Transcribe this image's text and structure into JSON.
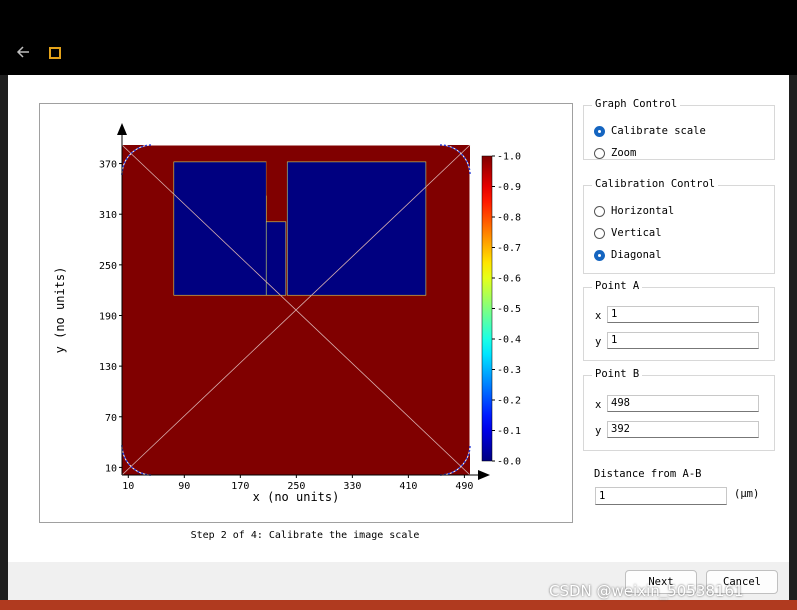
{
  "graph_control": {
    "title": "Graph Control",
    "options": [
      "Calibrate scale",
      "Zoom"
    ],
    "selected": "Calibrate scale"
  },
  "calibration_control": {
    "title": "Calibration Control",
    "options": [
      "Horizontal",
      "Vertical",
      "Diagonal"
    ],
    "selected": "Diagonal"
  },
  "point_a": {
    "title": "Point A",
    "x_label": "x",
    "x_value": "1",
    "y_label": "y",
    "y_value": "1"
  },
  "point_b": {
    "title": "Point B",
    "x_label": "x",
    "x_value": "498",
    "y_label": "y",
    "y_value": "392"
  },
  "distance": {
    "label": "Distance from A-B",
    "value": "1",
    "unit": "(μm)"
  },
  "step_label": "Step 2 of 4: Calibrate the image scale",
  "buttons": {
    "next": "Next",
    "cancel": "Cancel"
  },
  "watermark": "CSDN @weixin_50538161",
  "colors": {
    "accent": "#1565c0",
    "image_background": "#800000",
    "image_regions": "#00008f",
    "app_icon": "#e3a21a"
  },
  "chart_data": {
    "type": "heatmap",
    "xlabel": "x (no units)",
    "ylabel": "y (no units)",
    "x_ticks": [
      "10",
      "90",
      "170",
      "250",
      "330",
      "410",
      "490"
    ],
    "y_ticks": [
      "10",
      "70",
      "130",
      "190",
      "250",
      "310",
      "370"
    ],
    "xlim": [
      1,
      498
    ],
    "ylim": [
      1,
      392
    ],
    "colorbar_ticks": [
      "0.0",
      "0.1",
      "0.2",
      "0.3",
      "0.4",
      "0.5",
      "0.6",
      "0.7",
      "0.8",
      "0.9",
      "1.0"
    ],
    "colorbar_range": [
      0,
      1
    ],
    "colormap": "jet",
    "background_value": 1.0,
    "regions": [
      {
        "value": 0.0,
        "x": [
          75,
          207
        ],
        "y": [
          214,
          372
        ]
      },
      {
        "value": 0.0,
        "x": [
          207,
          235
        ],
        "y": [
          214,
          301
        ]
      },
      {
        "value": 0.0,
        "x": [
          237,
          435
        ],
        "y": [
          214,
          372
        ]
      }
    ],
    "calibration_line": {
      "from": [
        1,
        1
      ],
      "to": [
        498,
        392
      ]
    }
  }
}
